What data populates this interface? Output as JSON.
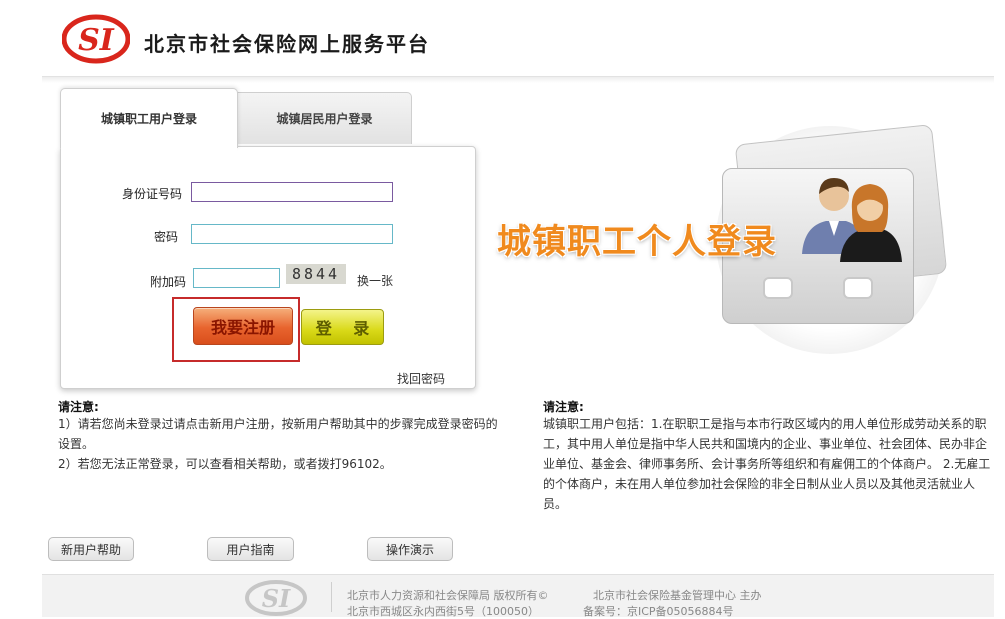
{
  "header": {
    "logo_text": "SI",
    "site_title": "北京市社会保险网上服务平台"
  },
  "tabs": [
    {
      "label": "城镇职工用户登录",
      "active": true
    },
    {
      "label": "城镇居民用户登录",
      "active": false
    }
  ],
  "form": {
    "id_label": "身份证号码",
    "id_value": "",
    "password_label": "密码",
    "password_value": "",
    "captcha_label": "附加码",
    "captcha_value": "",
    "captcha_image_text": "8844",
    "refresh_captcha": "换一张",
    "register_button": "我要注册",
    "login_button": "登 录",
    "recover_password": "找回密码"
  },
  "promo": {
    "text": "城镇职工个人登录"
  },
  "notice_left": {
    "title": "请注意:",
    "line1": "1）请若您尚未登录过请点击新用户注册，按新用户帮助其中的步骤完成登录密码的",
    "line2": "设置。",
    "line3": "2）若您无法正常登录，可以查看相关帮助，或者拨打96102。"
  },
  "notice_right": {
    "title": "请注意:",
    "line1": "城镇职工用户包括：1.在职职工是指与本市行政区域内的用人单位形成劳动关系的职",
    "line2": "工，其中用人单位是指中华人民共和国境内的企业、事业单位、社会团体、民办非企",
    "line3": "业单位、基金会、律师事务所、会计事务所等组织和有雇佣工的个体商户。 2.无雇工",
    "line4": "的个体商户，未在用人单位参加社会保险的非全日制从业人员以及其他灵活就业人",
    "line5": "员。"
  },
  "bottom_buttons": {
    "help": "新用户帮助",
    "guide": "用户指南",
    "demo": "操作演示"
  },
  "footer": {
    "logo_text": "SI",
    "left_line1": "北京市人力资源和社会保障局 版权所有©",
    "left_line2": "北京市西城区永内西街5号（100050）",
    "right_line1": "北京市社会保险基金管理中心  主办",
    "right_line2": "备案号：京ICP备05056884号"
  },
  "colors": {
    "brand_red": "#d9261c",
    "promo_orange": "#f08a1e",
    "register_orange": "#e8642e",
    "login_yellow": "#d9d918",
    "input_border": "#66b8c8"
  }
}
